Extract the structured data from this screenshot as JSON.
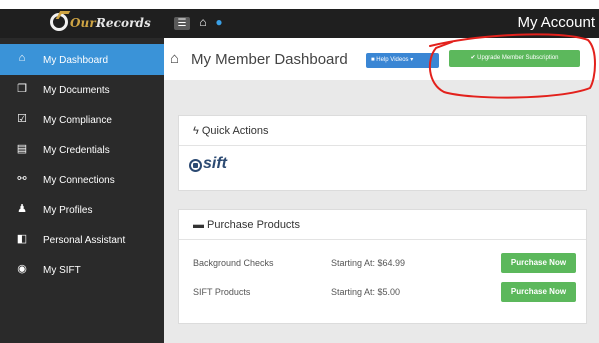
{
  "header": {
    "logo_text_a": "Our",
    "logo_text_b": "Records",
    "account_label": "My Account",
    "menu_toggle_glyph": "☰",
    "home_glyph": "⌂",
    "user_glyph": "●"
  },
  "sidebar": {
    "items": [
      {
        "label": "My Dashboard",
        "icon": "home-icon",
        "glyph": "⌂",
        "active": true
      },
      {
        "label": "My Documents",
        "icon": "documents-icon",
        "glyph": "❐"
      },
      {
        "label": "My Compliance",
        "icon": "checkbox-icon",
        "glyph": "☑"
      },
      {
        "label": "My Credentials",
        "icon": "file-icon",
        "glyph": "▤"
      },
      {
        "label": "My Connections",
        "icon": "link-icon",
        "glyph": "⚯"
      },
      {
        "label": "My Profiles",
        "icon": "users-icon",
        "glyph": "♟"
      },
      {
        "label": "Personal Assistant",
        "icon": "assistant-icon",
        "glyph": "◧"
      },
      {
        "label": "My SIFT",
        "icon": "sift-icon",
        "glyph": "◉"
      }
    ]
  },
  "main": {
    "home_glyph": "⌂",
    "title": "My Member Dashboard",
    "help_videos_label": "■ Help Videos ▾",
    "upgrade_label": "✔ Upgrade Member Subscription",
    "quick_actions": {
      "title": "ϟ Quick Actions",
      "sift_logo_text": "sift"
    },
    "purchase_products": {
      "title": "▬ Purchase Products",
      "rows": [
        {
          "name": "Background Checks",
          "price": "Starting At: $64.99",
          "button": "Purchase Now"
        },
        {
          "name": "SIFT Products",
          "price": "Starting At: $5.00",
          "button": "Purchase Now"
        }
      ]
    }
  },
  "colors": {
    "topbar": "#1f1f1f",
    "sidebar": "#2a2a2a",
    "active_item": "#3a93d8",
    "help_button": "#3a86d4",
    "green_button": "#5cb85c",
    "annotation_red": "#e3211c"
  }
}
